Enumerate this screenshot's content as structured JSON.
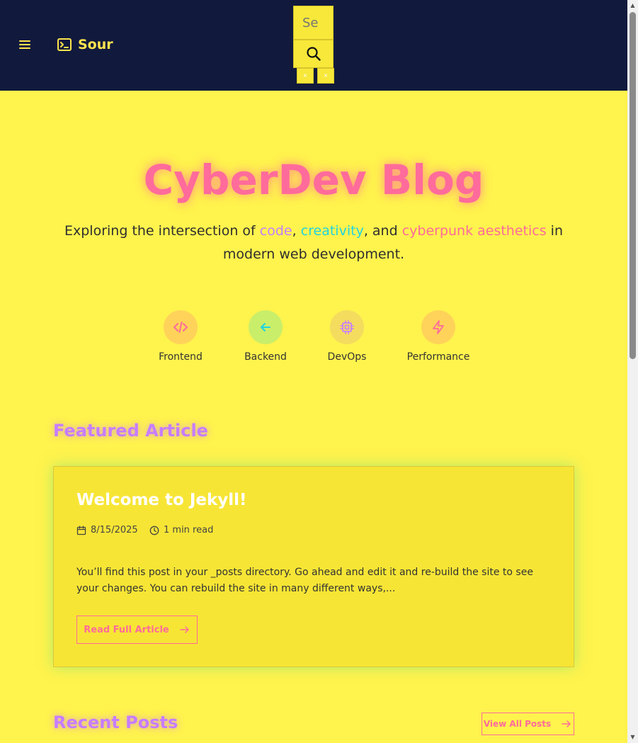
{
  "header": {
    "brand_text": "Sour",
    "search_placeholder": "Se",
    "mini_buttons": [
      "×",
      "×"
    ]
  },
  "hero": {
    "title": "CyberDev Blog",
    "subtitle_parts": {
      "p1": "Exploring the intersection of ",
      "w1": "code",
      "p2": ", ",
      "w2": "creativity",
      "p3": ", and ",
      "w3": "cyberpunk aesthetics",
      "p4": " in modern web development."
    }
  },
  "categories": [
    {
      "label": "Frontend",
      "icon": "code-icon",
      "color": "#ff6b9b"
    },
    {
      "label": "Backend",
      "icon": "arrow-left-icon",
      "color": "#1fd4e0"
    },
    {
      "label": "DevOps",
      "icon": "cpu-icon",
      "color": "#c77dff"
    },
    {
      "label": "Performance",
      "icon": "zap-icon",
      "color": "#ff6b9b"
    }
  ],
  "featured": {
    "section_title": "Featured Article",
    "title": "Welcome to Jekyll!",
    "date": "8/15/2025",
    "read_time": "1 min read",
    "excerpt": "You’ll find this post in your _posts directory. Go ahead and edit it and re-build the site to see your changes. You can rebuild the site in many different ways,...",
    "button_label": "Read Full Article"
  },
  "recent": {
    "section_title": "Recent Posts",
    "button_label": "View All Posts"
  },
  "colors": {
    "background": "#fff34d",
    "header_bg": "#111a3d",
    "pink": "#ff6b9b",
    "purple": "#c77dff",
    "cyan": "#1fd4e0"
  }
}
